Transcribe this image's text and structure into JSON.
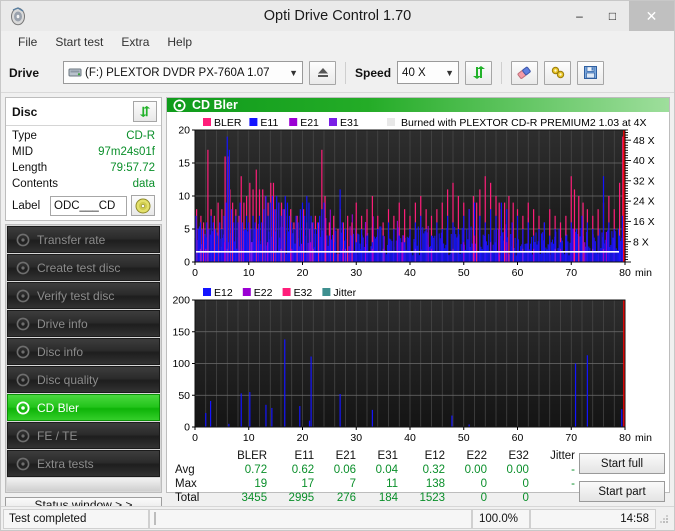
{
  "window": {
    "title": "Opti Drive Control 1.70",
    "icon": "disc-icon",
    "minimize": "–",
    "maximize": "□",
    "close": "✕"
  },
  "menu": {
    "items": [
      {
        "label": "File"
      },
      {
        "label": "Start test"
      },
      {
        "label": "Extra"
      },
      {
        "label": "Help"
      }
    ]
  },
  "toolbar": {
    "drive_label": "Drive",
    "drive_value": "(F:)  PLEXTOR DVDR  PX-760A 1.07",
    "drive_icon": "drive-icon",
    "eject_icon": "eject-icon",
    "speed_label": "Speed",
    "speed_value": "40 X",
    "refresh_icon": "refresh-icon",
    "erase_icon": "eraser-icon",
    "settings_icon": "settings-icon",
    "save_icon": "save-icon"
  },
  "disc_panel": {
    "title": "Disc",
    "refresh_icon": "refresh-icon",
    "rows": [
      {
        "key": "Type",
        "value": "CD-R"
      },
      {
        "key": "MID",
        "value": "97m24s01f"
      },
      {
        "key": "Length",
        "value": "79:57.72"
      },
      {
        "key": "Contents",
        "value": "data"
      }
    ],
    "label_key": "Label",
    "label_value": "ODC___CD",
    "label_button_icon": "cd-icon"
  },
  "nav": {
    "items": [
      {
        "label": "Transfer rate",
        "icon": "disc-test-icon",
        "active": false
      },
      {
        "label": "Create test disc",
        "icon": "disc-create-icon",
        "active": false
      },
      {
        "label": "Verify test disc",
        "icon": "disc-verify-icon",
        "active": false
      },
      {
        "label": "Drive info",
        "icon": "drive-info-icon",
        "active": false
      },
      {
        "label": "Disc info",
        "icon": "disc-info-icon",
        "active": false
      },
      {
        "label": "Disc quality",
        "icon": "disc-quality-icon",
        "active": false
      },
      {
        "label": "CD Bler",
        "icon": "cd-bler-icon",
        "active": true
      },
      {
        "label": "FE / TE",
        "icon": "fe-te-icon",
        "active": false
      },
      {
        "label": "Extra tests",
        "icon": "extra-tests-icon",
        "active": false
      }
    ],
    "status_window": "Status window > >"
  },
  "main_panel": {
    "title": "CD Bler",
    "icon": "cd-bler-icon",
    "burn_info": "Burned with PLEXTOR CD-R   PREMIUM2 1.03 at 4X"
  },
  "stats": {
    "columns": [
      "BLER",
      "E11",
      "E21",
      "E31",
      "E12",
      "E22",
      "E32",
      "Jitter"
    ],
    "rows": [
      {
        "label": "Avg",
        "values": [
          "0.72",
          "0.62",
          "0.06",
          "0.04",
          "0.32",
          "0.00",
          "0.00",
          "-"
        ]
      },
      {
        "label": "Max",
        "values": [
          "19",
          "17",
          "7",
          "11",
          "138",
          "0",
          "0",
          "-"
        ]
      },
      {
        "label": "Total",
        "values": [
          "3455",
          "2995",
          "276",
          "184",
          "1523",
          "0",
          "0",
          ""
        ]
      }
    ],
    "start_full": "Start full",
    "start_part": "Start part"
  },
  "statusbar": {
    "message": "Test completed",
    "percent_label": "100.0%",
    "percent_value": 100,
    "time": "14:58"
  },
  "chart_data": [
    {
      "type": "bar",
      "id": "cd-bler-error-chart",
      "title": "",
      "annotation": "Burned with PLEXTOR CD-R   PREMIUM2 1.03 at 4X",
      "xlabel": "min",
      "ylabel": "",
      "xlim": [
        0,
        80
      ],
      "ylim": [
        0,
        20
      ],
      "xticks": [
        0,
        10,
        20,
        30,
        40,
        50,
        60,
        70,
        80
      ],
      "yticks": [
        0,
        5,
        10,
        15,
        20
      ],
      "right_axis": {
        "label": "X",
        "ticks": [
          "8 X",
          "16 X",
          "24 X",
          "32 X",
          "40 X",
          "48 X"
        ],
        "values": [
          8,
          16,
          24,
          32,
          40,
          48
        ],
        "lim": [
          0,
          52
        ]
      },
      "grid": true,
      "legend_position": "top-left",
      "legend": [
        {
          "name": "BLER",
          "color": "#ff1e7a"
        },
        {
          "name": "E11",
          "color": "#1414ff"
        },
        {
          "name": "E21",
          "color": "#9b00d4"
        },
        {
          "name": "E31",
          "color": "#7a1ee6"
        }
      ],
      "speed_line": {
        "color": "#ffffff",
        "value": 4,
        "note": "write/read speed trace ~4X flat"
      },
      "speed_end_marker": {
        "color": "#ff0000",
        "x": 80
      },
      "series": [
        {
          "name": "BLER",
          "color": "#ff1e7a",
          "x": [
            0.3,
            1.1,
            1.6,
            2.4,
            3.0,
            3.6,
            4.3,
            5.0,
            5.6,
            6.1,
            6.5,
            7.0,
            7.6,
            8.2,
            8.6,
            9.1,
            9.6,
            10.2,
            10.8,
            11.4,
            12.0,
            12.6,
            13.1,
            13.6,
            14.1,
            14.6,
            15.1,
            15.6,
            16.1,
            16.6,
            17.2,
            17.8,
            18.4,
            19.0,
            19.6,
            20.2,
            20.8,
            21.3,
            21.8,
            22.4,
            23.0,
            23.6,
            24.2,
            25.0,
            25.8,
            26.6,
            27.0,
            27.6,
            28.4,
            29.2,
            30.0,
            31.0,
            32.0,
            33.0,
            34.0,
            35.0,
            36.0,
            37.0,
            38.0,
            39.0,
            40.0,
            41.0,
            42.0,
            43.0,
            44.0,
            45.0,
            46.0,
            47.0,
            48.0,
            49.0,
            50.0,
            51.0,
            51.8,
            52.4,
            53.0,
            54.0,
            55.0,
            56.0,
            56.6,
            57.0,
            57.6,
            58.4,
            59.2,
            60.0,
            61.0,
            62.0,
            63.0,
            64.0,
            65.0,
            66.0,
            67.0,
            68.0,
            69.0,
            70.0,
            70.6,
            71.4,
            72.2,
            73.0,
            74.0,
            75.0,
            76.0,
            77.0,
            78.0,
            79.0,
            79.6,
            80.0
          ],
          "y": [
            8,
            7,
            6,
            17,
            8,
            7,
            9,
            8,
            16,
            16,
            11,
            9,
            8,
            7,
            13,
            9,
            10,
            12,
            11,
            14,
            11,
            11,
            10,
            9,
            12,
            12,
            8,
            9,
            9,
            8,
            7,
            8,
            6,
            7,
            7,
            8,
            6,
            5,
            6,
            7,
            6,
            17,
            10,
            6,
            7,
            5,
            8,
            6,
            7,
            6,
            9,
            7,
            8,
            10,
            7,
            6,
            8,
            7,
            9,
            8,
            7,
            9,
            10,
            8,
            7,
            8,
            9,
            11,
            12,
            10,
            9,
            8,
            10,
            9,
            11,
            13,
            12,
            10,
            9,
            8,
            9,
            10,
            9,
            8,
            7,
            9,
            8,
            7,
            6,
            8,
            7,
            6,
            7,
            13,
            11,
            10,
            9,
            8,
            7,
            8,
            9,
            10,
            8,
            12,
            19,
            19
          ]
        },
        {
          "name": "E11",
          "color": "#1414ff",
          "x": [
            0.2,
            0.6,
            1.0,
            1.4,
            1.8,
            2.2,
            2.6,
            3.0,
            3.4,
            3.8,
            4.2,
            4.6,
            5.0,
            5.4,
            5.8,
            6.0,
            6.4,
            6.8,
            7.2,
            7.6,
            8.0,
            8.4,
            8.8,
            9.2,
            9.6,
            10.0,
            10.4,
            10.8,
            11.2,
            11.6,
            12.0,
            12.4,
            12.8,
            13.2,
            13.6,
            14.0,
            14.4,
            14.8,
            15.2,
            15.6,
            16.0,
            16.4,
            16.8,
            17.2,
            17.6,
            18.0,
            18.4,
            18.8,
            19.2,
            19.6,
            20.0,
            20.4,
            20.8,
            21.2,
            21.6,
            22.0,
            22.4,
            22.8,
            23.2,
            23.6,
            24.0,
            25.0,
            26.0,
            27.0,
            27.4,
            28.0,
            29.0,
            30.0,
            31.0,
            32.0,
            33.0,
            34.0,
            35.0,
            36.0,
            37.0,
            38.0,
            39.0,
            40.0,
            41.0,
            42.0,
            43.0,
            44.0,
            45.0,
            46.0,
            47.0,
            48.0,
            49.0,
            50.0,
            51.0,
            52.0,
            53.0,
            54.0,
            55.0,
            56.0,
            57.0,
            58.0,
            59.0,
            60.0,
            61.0,
            62.0,
            63.0,
            64.0,
            65.0,
            66.0,
            67.0,
            68.0,
            69.0,
            70.0,
            71.0,
            72.0,
            73.0,
            74.0,
            75.0,
            76.0,
            77.0,
            78.0,
            79.0,
            79.5,
            80.0
          ],
          "y": [
            7,
            5,
            6,
            5,
            4,
            6,
            5,
            7,
            6,
            5,
            4,
            6,
            5,
            7,
            9,
            19,
            17,
            8,
            6,
            7,
            6,
            9,
            6,
            5,
            7,
            6,
            5,
            7,
            6,
            5,
            7,
            6,
            8,
            10,
            7,
            9,
            10,
            8,
            10,
            9,
            7,
            8,
            10,
            9,
            7,
            6,
            5,
            7,
            6,
            8,
            9,
            7,
            10,
            9,
            7,
            6,
            5,
            6,
            7,
            8,
            9,
            4,
            3,
            11,
            6,
            5,
            4,
            3,
            5,
            4,
            3,
            5,
            4,
            6,
            5,
            4,
            3,
            5,
            6,
            7,
            5,
            4,
            6,
            5,
            7,
            6,
            5,
            7,
            8,
            9,
            7,
            6,
            8,
            7,
            9,
            8,
            6,
            7,
            5,
            6,
            4,
            5,
            6,
            4,
            5,
            3,
            4,
            6,
            5,
            7,
            6,
            5,
            4,
            13,
            6,
            5,
            4,
            7,
            9
          ]
        },
        {
          "name": "E21",
          "color": "#9b00d4",
          "x": [
            2.0,
            5.5,
            9.0,
            13.5,
            18.0,
            21.5,
            27.5,
            33.0,
            38.5,
            44.0,
            50.0,
            52.0,
            56.5,
            58.0,
            63.0,
            68.0,
            72.5,
            76.0,
            79.8
          ],
          "y": [
            2,
            3,
            2,
            3,
            2,
            3,
            2,
            2,
            3,
            2,
            3,
            4,
            5,
            3,
            2,
            2,
            3,
            2,
            4
          ]
        },
        {
          "name": "E31",
          "color": "#7a1ee6",
          "x": [
            1.0,
            6.0,
            10.5,
            16.0,
            22.0,
            28.0,
            35.0,
            41.0,
            48.0,
            55.0,
            61.0,
            67.0,
            74.0,
            79.9
          ],
          "y": [
            2,
            2,
            3,
            2,
            2,
            2,
            2,
            2,
            2,
            3,
            2,
            2,
            2,
            3
          ]
        }
      ]
    },
    {
      "type": "bar",
      "id": "cd-bler-e12-chart",
      "title": "",
      "xlabel": "min",
      "ylabel": "",
      "xlim": [
        0,
        80
      ],
      "ylim": [
        0,
        200
      ],
      "xticks": [
        0,
        10,
        20,
        30,
        40,
        50,
        60,
        70,
        80
      ],
      "yticks": [
        0,
        50,
        100,
        150,
        200
      ],
      "grid": true,
      "legend_position": "top-left",
      "legend": [
        {
          "name": "E12",
          "color": "#1414ff"
        },
        {
          "name": "E22",
          "color": "#9b00d4"
        },
        {
          "name": "E32",
          "color": "#ff1e7a"
        },
        {
          "name": "Jitter",
          "color": "#3e8f8f"
        }
      ],
      "end_marker": {
        "color": "#ff0000",
        "x": 80
      },
      "series": [
        {
          "name": "E12",
          "color": "#1414ff",
          "x": [
            2.0,
            2.9,
            6.3,
            8.6,
            10.2,
            13.2,
            14.3,
            16.7,
            19.5,
            21.3,
            21.6,
            27.0,
            33.0,
            47.8,
            51.0,
            70.8,
            73.0,
            79.4,
            79.8
          ],
          "y": [
            22,
            41,
            5,
            53,
            55,
            35,
            30,
            138,
            33,
            10,
            111,
            52,
            27,
            18,
            4,
            100,
            113,
            28,
            20
          ]
        },
        {
          "name": "E22",
          "color": "#9b00d4",
          "x": [],
          "y": []
        },
        {
          "name": "E32",
          "color": "#ff1e7a",
          "x": [],
          "y": []
        },
        {
          "name": "Jitter",
          "color": "#3e8f8f",
          "x": [],
          "y": []
        }
      ]
    }
  ]
}
